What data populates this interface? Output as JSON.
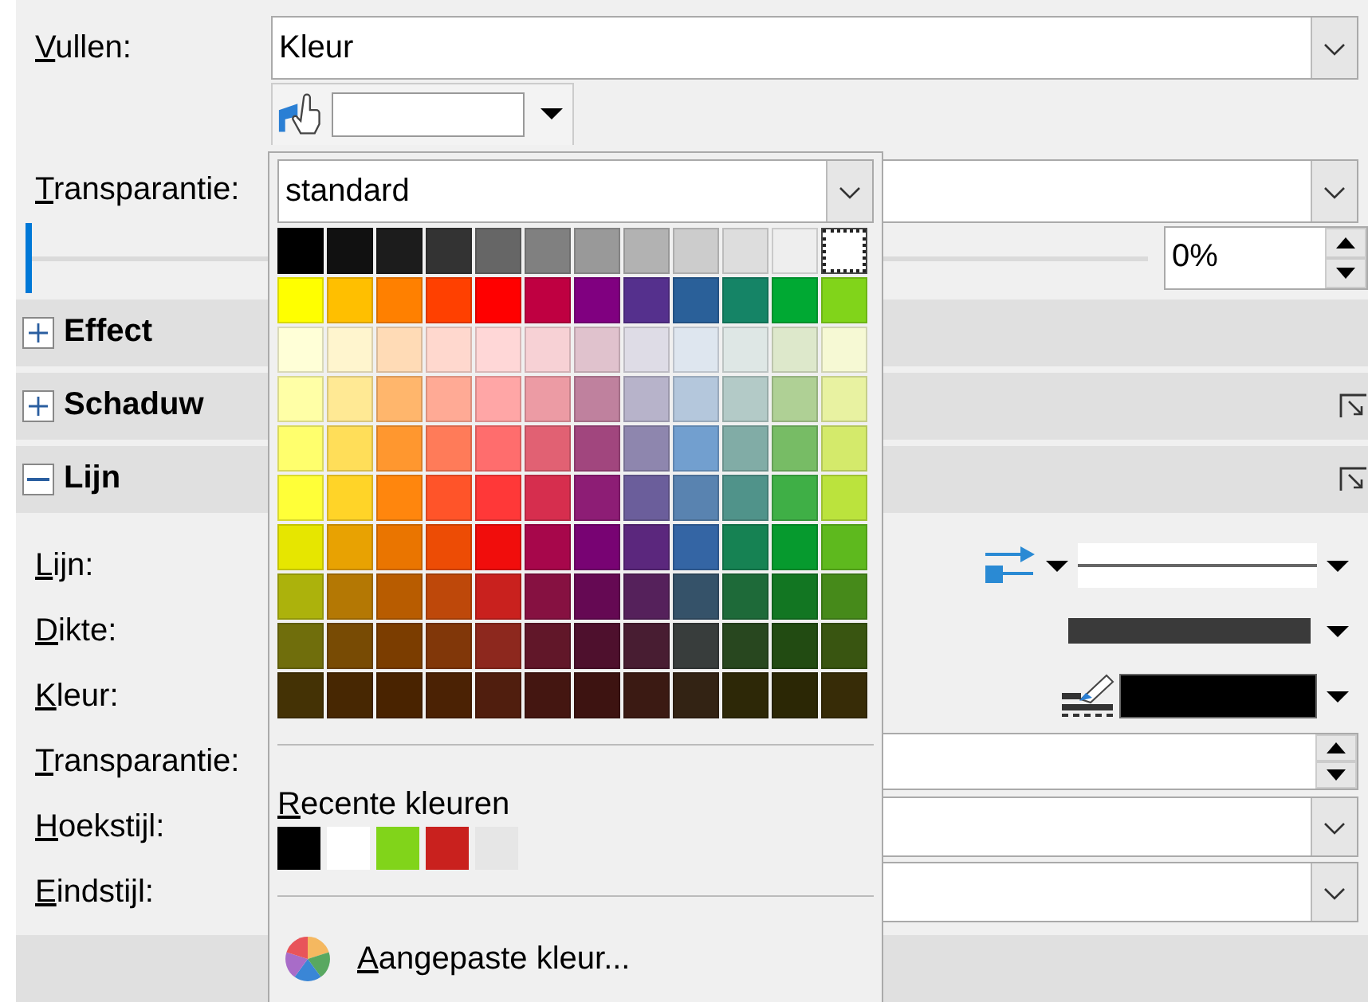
{
  "fill": {
    "label": "Vullen:",
    "value": "Kleur"
  },
  "transparency": {
    "label": "Transparantie:",
    "slider": {
      "level": 0
    },
    "value": "0%"
  },
  "sections": [
    {
      "title": "Effect",
      "expanded": false,
      "more_button": false
    },
    {
      "title": "Schaduw",
      "expanded": false,
      "more_button": true
    },
    {
      "title": "Lijn",
      "expanded": true,
      "more_button": true
    }
  ],
  "line_rows": [
    {
      "kind": "line-style",
      "label": "Lijn:"
    },
    {
      "kind": "thickness",
      "label": "Dikte:"
    },
    {
      "kind": "color",
      "label": "Kleur:"
    },
    {
      "kind": "spin",
      "label": "Transparantie:"
    },
    {
      "kind": "combo",
      "label": "Hoekstijl:"
    },
    {
      "kind": "combo",
      "label": "Eindstijl:"
    }
  ],
  "color_popup": {
    "palette": "standard",
    "swatches": [
      {
        "color": "#000000",
        "selected": false
      },
      {
        "color": "#111111",
        "selected": false
      },
      {
        "color": "#1c1c1c",
        "selected": false
      },
      {
        "color": "#333333",
        "selected": false
      },
      {
        "color": "#666666",
        "selected": false
      },
      {
        "color": "#808080",
        "selected": false
      },
      {
        "color": "#999999",
        "selected": false
      },
      {
        "color": "#b2b2b2",
        "selected": false
      },
      {
        "color": "#cccccc",
        "selected": false
      },
      {
        "color": "#dddddd",
        "selected": false
      },
      {
        "color": "#eeeeee",
        "selected": false
      },
      {
        "color": "#ffffff",
        "selected": true
      },
      {
        "color": "#ffff00",
        "selected": false
      },
      {
        "color": "#ffbf00",
        "selected": false
      },
      {
        "color": "#ff8000",
        "selected": false
      },
      {
        "color": "#ff4000",
        "selected": false
      },
      {
        "color": "#ff0000",
        "selected": false
      },
      {
        "color": "#bf0041",
        "selected": false
      },
      {
        "color": "#800080",
        "selected": false
      },
      {
        "color": "#55308d",
        "selected": false
      },
      {
        "color": "#2a6099",
        "selected": false
      },
      {
        "color": "#158466",
        "selected": false
      },
      {
        "color": "#00a933",
        "selected": false
      },
      {
        "color": "#81d41a",
        "selected": false
      },
      {
        "color": "#ffffd7",
        "selected": false
      },
      {
        "color": "#fff5ce",
        "selected": false
      },
      {
        "color": "#ffdbb6",
        "selected": false
      },
      {
        "color": "#ffd8ce",
        "selected": false
      },
      {
        "color": "#ffd7d7",
        "selected": false
      },
      {
        "color": "#f7d1d5",
        "selected": false
      },
      {
        "color": "#e0c2cd",
        "selected": false
      },
      {
        "color": "#dedce6",
        "selected": false
      },
      {
        "color": "#dee6ef",
        "selected": false
      },
      {
        "color": "#dee7e5",
        "selected": false
      },
      {
        "color": "#dde8cb",
        "selected": false
      },
      {
        "color": "#f6f9d4",
        "selected": false
      },
      {
        "color": "#ffffa6",
        "selected": false
      },
      {
        "color": "#ffe994",
        "selected": false
      },
      {
        "color": "#ffb66c",
        "selected": false
      },
      {
        "color": "#ffaa95",
        "selected": false
      },
      {
        "color": "#ffa6a6",
        "selected": false
      },
      {
        "color": "#ec9ba4",
        "selected": false
      },
      {
        "color": "#bf819e",
        "selected": false
      },
      {
        "color": "#b7b3ca",
        "selected": false
      },
      {
        "color": "#b4c7dc",
        "selected": false
      },
      {
        "color": "#b3cac7",
        "selected": false
      },
      {
        "color": "#afd095",
        "selected": false
      },
      {
        "color": "#e8f2a1",
        "selected": false
      },
      {
        "color": "#ffff6d",
        "selected": false
      },
      {
        "color": "#ffde59",
        "selected": false
      },
      {
        "color": "#ff972f",
        "selected": false
      },
      {
        "color": "#ff7b59",
        "selected": false
      },
      {
        "color": "#ff6d6d",
        "selected": false
      },
      {
        "color": "#e16173",
        "selected": false
      },
      {
        "color": "#a1467e",
        "selected": false
      },
      {
        "color": "#8e86ae",
        "selected": false
      },
      {
        "color": "#729fcf",
        "selected": false
      },
      {
        "color": "#81aca6",
        "selected": false
      },
      {
        "color": "#77bc65",
        "selected": false
      },
      {
        "color": "#d4ea6b",
        "selected": false
      },
      {
        "color": "#ffff38",
        "selected": false
      },
      {
        "color": "#ffd428",
        "selected": false
      },
      {
        "color": "#ff860d",
        "selected": false
      },
      {
        "color": "#ff5429",
        "selected": false
      },
      {
        "color": "#ff3838",
        "selected": false
      },
      {
        "color": "#d62e4e",
        "selected": false
      },
      {
        "color": "#8d1d75",
        "selected": false
      },
      {
        "color": "#6b5e9b",
        "selected": false
      },
      {
        "color": "#5983b0",
        "selected": false
      },
      {
        "color": "#50938a",
        "selected": false
      },
      {
        "color": "#3faf46",
        "selected": false
      },
      {
        "color": "#bbe33d",
        "selected": false
      },
      {
        "color": "#e6e600",
        "selected": false
      },
      {
        "color": "#e8a202",
        "selected": false
      },
      {
        "color": "#ea7500",
        "selected": false
      },
      {
        "color": "#ed4c05",
        "selected": false
      },
      {
        "color": "#f10d0c",
        "selected": false
      },
      {
        "color": "#a7074b",
        "selected": false
      },
      {
        "color": "#780373",
        "selected": false
      },
      {
        "color": "#5b277d",
        "selected": false
      },
      {
        "color": "#3465a4",
        "selected": false
      },
      {
        "color": "#168253",
        "selected": false
      },
      {
        "color": "#069a2e",
        "selected": false
      },
      {
        "color": "#5eb91e",
        "selected": false
      },
      {
        "color": "#acb20c",
        "selected": false
      },
      {
        "color": "#b47804",
        "selected": false
      },
      {
        "color": "#b85c00",
        "selected": false
      },
      {
        "color": "#be480a",
        "selected": false
      },
      {
        "color": "#c9211e",
        "selected": false
      },
      {
        "color": "#861141",
        "selected": false
      },
      {
        "color": "#650953",
        "selected": false
      },
      {
        "color": "#55215b",
        "selected": false
      },
      {
        "color": "#355269",
        "selected": false
      },
      {
        "color": "#1e6a39",
        "selected": false
      },
      {
        "color": "#127622",
        "selected": false
      },
      {
        "color": "#468a1a",
        "selected": false
      },
      {
        "color": "#706e0c",
        "selected": false
      },
      {
        "color": "#784b04",
        "selected": false
      },
      {
        "color": "#7b3d00",
        "selected": false
      },
      {
        "color": "#813709",
        "selected": false
      },
      {
        "color": "#8d281e",
        "selected": false
      },
      {
        "color": "#611729",
        "selected": false
      },
      {
        "color": "#4e102d",
        "selected": false
      },
      {
        "color": "#481d32",
        "selected": false
      },
      {
        "color": "#383d3c",
        "selected": false
      },
      {
        "color": "#28471f",
        "selected": false
      },
      {
        "color": "#224b12",
        "selected": false
      },
      {
        "color": "#395511",
        "selected": false
      },
      {
        "color": "#443205",
        "selected": false
      },
      {
        "color": "#472702",
        "selected": false
      },
      {
        "color": "#492300",
        "selected": false
      },
      {
        "color": "#4b2204",
        "selected": false
      },
      {
        "color": "#501e0e",
        "selected": false
      },
      {
        "color": "#441611",
        "selected": false
      },
      {
        "color": "#3d1311",
        "selected": false
      },
      {
        "color": "#3b1a13",
        "selected": false
      },
      {
        "color": "#332314",
        "selected": false
      },
      {
        "color": "#2d2807",
        "selected": false
      },
      {
        "color": "#2b2705",
        "selected": false
      },
      {
        "color": "#372c07",
        "selected": false
      }
    ],
    "recent_label": "Recente kleuren",
    "recent": [
      {
        "color": "#000000"
      },
      {
        "color": "#ffffff"
      },
      {
        "color": "#81d41a"
      },
      {
        "color": "#c9211e"
      },
      {
        "color": "#e6e6e6"
      }
    ],
    "custom_button": "Aangepaste kleur..."
  }
}
